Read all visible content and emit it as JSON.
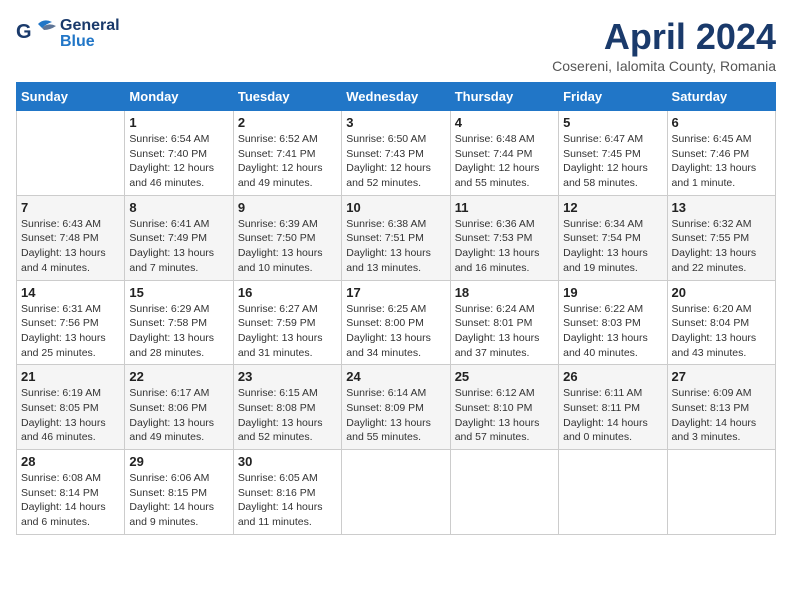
{
  "header": {
    "logo_general": "General",
    "logo_blue": "Blue",
    "month_title": "April 2024",
    "subtitle": "Cosereni, Ialomita County, Romania"
  },
  "weekdays": [
    "Sunday",
    "Monday",
    "Tuesday",
    "Wednesday",
    "Thursday",
    "Friday",
    "Saturday"
  ],
  "weeks": [
    [
      {
        "day": "",
        "info": ""
      },
      {
        "day": "1",
        "info": "Sunrise: 6:54 AM\nSunset: 7:40 PM\nDaylight: 12 hours\nand 46 minutes."
      },
      {
        "day": "2",
        "info": "Sunrise: 6:52 AM\nSunset: 7:41 PM\nDaylight: 12 hours\nand 49 minutes."
      },
      {
        "day": "3",
        "info": "Sunrise: 6:50 AM\nSunset: 7:43 PM\nDaylight: 12 hours\nand 52 minutes."
      },
      {
        "day": "4",
        "info": "Sunrise: 6:48 AM\nSunset: 7:44 PM\nDaylight: 12 hours\nand 55 minutes."
      },
      {
        "day": "5",
        "info": "Sunrise: 6:47 AM\nSunset: 7:45 PM\nDaylight: 12 hours\nand 58 minutes."
      },
      {
        "day": "6",
        "info": "Sunrise: 6:45 AM\nSunset: 7:46 PM\nDaylight: 13 hours\nand 1 minute."
      }
    ],
    [
      {
        "day": "7",
        "info": "Sunrise: 6:43 AM\nSunset: 7:48 PM\nDaylight: 13 hours\nand 4 minutes."
      },
      {
        "day": "8",
        "info": "Sunrise: 6:41 AM\nSunset: 7:49 PM\nDaylight: 13 hours\nand 7 minutes."
      },
      {
        "day": "9",
        "info": "Sunrise: 6:39 AM\nSunset: 7:50 PM\nDaylight: 13 hours\nand 10 minutes."
      },
      {
        "day": "10",
        "info": "Sunrise: 6:38 AM\nSunset: 7:51 PM\nDaylight: 13 hours\nand 13 minutes."
      },
      {
        "day": "11",
        "info": "Sunrise: 6:36 AM\nSunset: 7:53 PM\nDaylight: 13 hours\nand 16 minutes."
      },
      {
        "day": "12",
        "info": "Sunrise: 6:34 AM\nSunset: 7:54 PM\nDaylight: 13 hours\nand 19 minutes."
      },
      {
        "day": "13",
        "info": "Sunrise: 6:32 AM\nSunset: 7:55 PM\nDaylight: 13 hours\nand 22 minutes."
      }
    ],
    [
      {
        "day": "14",
        "info": "Sunrise: 6:31 AM\nSunset: 7:56 PM\nDaylight: 13 hours\nand 25 minutes."
      },
      {
        "day": "15",
        "info": "Sunrise: 6:29 AM\nSunset: 7:58 PM\nDaylight: 13 hours\nand 28 minutes."
      },
      {
        "day": "16",
        "info": "Sunrise: 6:27 AM\nSunset: 7:59 PM\nDaylight: 13 hours\nand 31 minutes."
      },
      {
        "day": "17",
        "info": "Sunrise: 6:25 AM\nSunset: 8:00 PM\nDaylight: 13 hours\nand 34 minutes."
      },
      {
        "day": "18",
        "info": "Sunrise: 6:24 AM\nSunset: 8:01 PM\nDaylight: 13 hours\nand 37 minutes."
      },
      {
        "day": "19",
        "info": "Sunrise: 6:22 AM\nSunset: 8:03 PM\nDaylight: 13 hours\nand 40 minutes."
      },
      {
        "day": "20",
        "info": "Sunrise: 6:20 AM\nSunset: 8:04 PM\nDaylight: 13 hours\nand 43 minutes."
      }
    ],
    [
      {
        "day": "21",
        "info": "Sunrise: 6:19 AM\nSunset: 8:05 PM\nDaylight: 13 hours\nand 46 minutes."
      },
      {
        "day": "22",
        "info": "Sunrise: 6:17 AM\nSunset: 8:06 PM\nDaylight: 13 hours\nand 49 minutes."
      },
      {
        "day": "23",
        "info": "Sunrise: 6:15 AM\nSunset: 8:08 PM\nDaylight: 13 hours\nand 52 minutes."
      },
      {
        "day": "24",
        "info": "Sunrise: 6:14 AM\nSunset: 8:09 PM\nDaylight: 13 hours\nand 55 minutes."
      },
      {
        "day": "25",
        "info": "Sunrise: 6:12 AM\nSunset: 8:10 PM\nDaylight: 13 hours\nand 57 minutes."
      },
      {
        "day": "26",
        "info": "Sunrise: 6:11 AM\nSunset: 8:11 PM\nDaylight: 14 hours\nand 0 minutes."
      },
      {
        "day": "27",
        "info": "Sunrise: 6:09 AM\nSunset: 8:13 PM\nDaylight: 14 hours\nand 3 minutes."
      }
    ],
    [
      {
        "day": "28",
        "info": "Sunrise: 6:08 AM\nSunset: 8:14 PM\nDaylight: 14 hours\nand 6 minutes."
      },
      {
        "day": "29",
        "info": "Sunrise: 6:06 AM\nSunset: 8:15 PM\nDaylight: 14 hours\nand 9 minutes."
      },
      {
        "day": "30",
        "info": "Sunrise: 6:05 AM\nSunset: 8:16 PM\nDaylight: 14 hours\nand 11 minutes."
      },
      {
        "day": "",
        "info": ""
      },
      {
        "day": "",
        "info": ""
      },
      {
        "day": "",
        "info": ""
      },
      {
        "day": "",
        "info": ""
      }
    ]
  ]
}
